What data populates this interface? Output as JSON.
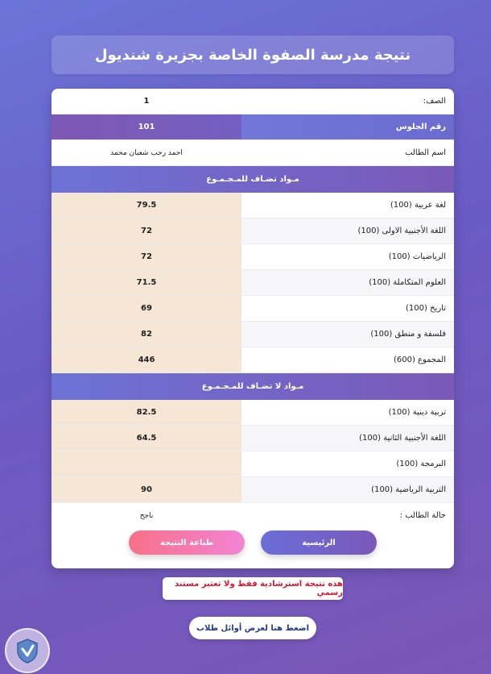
{
  "header": {
    "title": "نتيجة مدرسة الصفوة الخاصة بجزيرة شنديول"
  },
  "info": [
    {
      "label": "الصف:",
      "value": "1"
    },
    {
      "label": "رقم الجلوس",
      "value": "101"
    },
    {
      "label": "اسم الطالب",
      "value": "احمد رجب شعبان محمد"
    }
  ],
  "sections": {
    "counted": "مـواد تضـاف للمـجـمـوع",
    "not_counted": "مـواد لا تضـاف للمـجـمـوع"
  },
  "counted_subjects": [
    {
      "label": "لغة عربية (100)",
      "value": "79.5"
    },
    {
      "label": "اللغة الأجنبية الاولى (100)",
      "value": "72"
    },
    {
      "label": "الرياضيات (100)",
      "value": "72"
    },
    {
      "label": "العلوم المتكاملة (100)",
      "value": "71.5"
    },
    {
      "label": "تاريخ (100)",
      "value": "69"
    },
    {
      "label": "فلسفة و منطق (100)",
      "value": "82"
    },
    {
      "label": "المجموع (600)",
      "value": "446"
    }
  ],
  "other_subjects": [
    {
      "label": "تربية دينية (100)",
      "value": "82.5"
    },
    {
      "label": "اللغة الأجنبية الثانية (100)",
      "value": "64.5"
    },
    {
      "label": "البرمجة (100)",
      "value": ""
    },
    {
      "label": "التربية الرياضية (100)",
      "value": "90"
    }
  ],
  "status": {
    "label": "حالة الطالب :",
    "value": "ناجح"
  },
  "buttons": {
    "home": "الرئيسية",
    "print": "طباعة النتيجة"
  },
  "notice": "هذه نتيجة استرشادية فقط ولا تعتبر مستند رسمي",
  "top_link": "اضغط هنا لعرض أوائل طلاب",
  "colors": {
    "accent": "#6a6ed8",
    "accent2": "#7b58b8",
    "score_bg": "#f5e6d6",
    "notice_red": "#e0112b"
  }
}
